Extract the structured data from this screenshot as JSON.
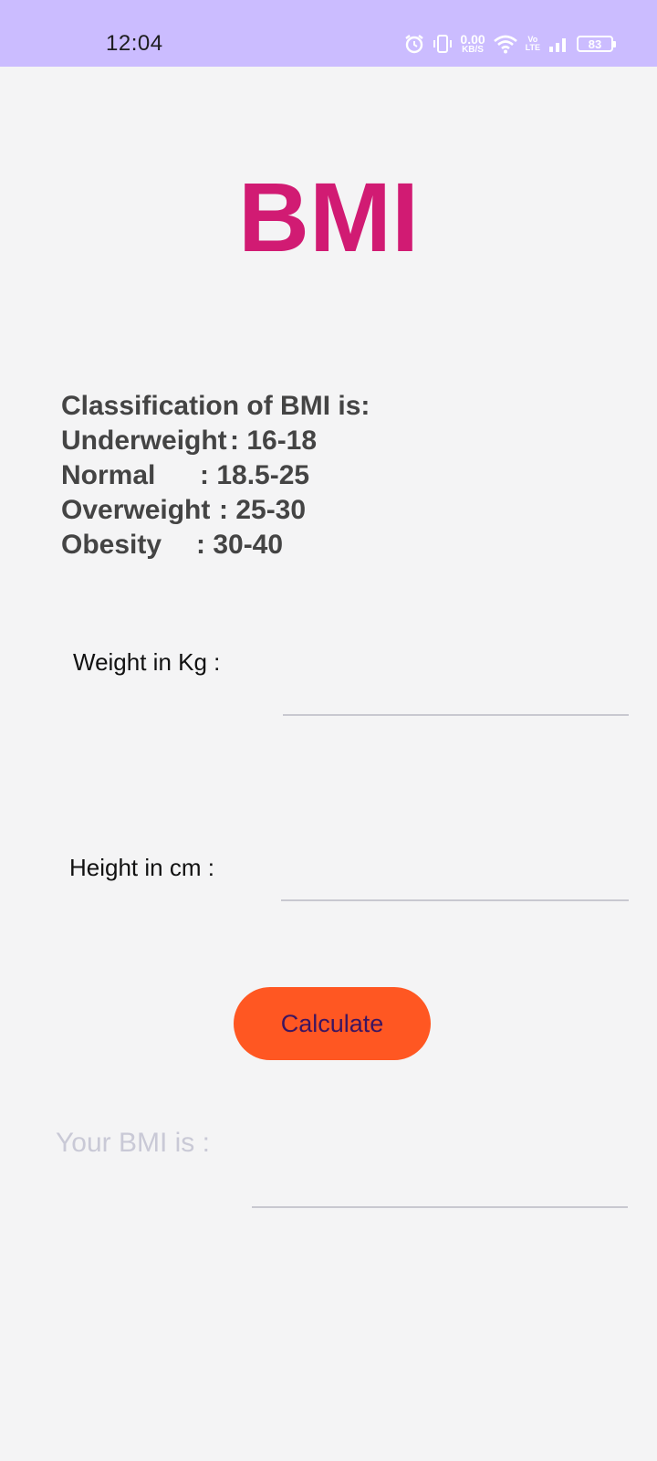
{
  "status_bar": {
    "time": "12:04",
    "net_speed_value": "0.00",
    "net_speed_unit": "KB/S",
    "volte_top": "Vo",
    "volte_bottom": "LTE",
    "battery": "83",
    "icons": [
      "alarm-icon",
      "vibrate-icon",
      "wifi-icon",
      "signal-icon",
      "battery-icon"
    ],
    "color": "#cbbcff"
  },
  "app": {
    "title": "BMI",
    "title_color": "#d11b73",
    "classification": {
      "heading": "Classification of BMI is:",
      "rows": [
        {
          "name": "Underweight",
          "range": ": 16-18"
        },
        {
          "name": "Normal",
          "range": ": 18.5-25"
        },
        {
          "name": "Overweight",
          "range": ": 25-30"
        },
        {
          "name": "Obesity",
          "range": ": 30-40"
        }
      ]
    },
    "weight": {
      "label": "Weight in Kg :",
      "value": "",
      "placeholder": ""
    },
    "height": {
      "label": "Height in cm :",
      "value": "",
      "placeholder": ""
    },
    "calculate_button": {
      "label": "Calculate",
      "color": "#ff5722"
    },
    "result": {
      "label": "Your BMI is :",
      "value": ""
    }
  }
}
